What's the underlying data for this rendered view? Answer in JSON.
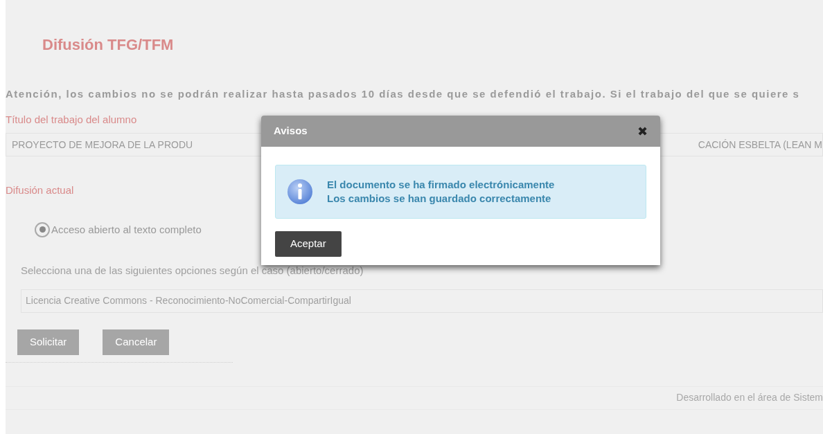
{
  "page": {
    "title": "Difusión TFG/TFM",
    "notice": "Atención, los cambios no se podrán realizar hasta pasados 10 días desde que se defendió el trabajo. Si el trabajo del que se quiere s",
    "title_label": "Título del trabajo del alumno",
    "title_field": {
      "value_start": "PROYECTO DE MEJORA DE LA PRODU",
      "value_end": "CACIÓN ESBELTA (LEAN M"
    },
    "diffusion_label": "Difusión actual",
    "diffusion_options": [
      {
        "label": "Acceso abierto al texto completo",
        "selected": true
      }
    ],
    "options_label": "Selecciona una de las siguientes opciones según el caso (abierto/cerrado)",
    "license_field": {
      "value": "Licencia Creative Commons - Reconocimiento-NoComercial-CompartirIgual"
    },
    "buttons": [
      "Solicitar",
      "Cancelar"
    ],
    "footer": "Desarrollado en el área de Sistem"
  },
  "dialog": {
    "title": "Avisos",
    "close": "✖",
    "messages": [
      "El documento se ha firmado electrónicamente",
      "Los cambios se han guardado correctamente"
    ],
    "button": "Aceptar"
  }
}
